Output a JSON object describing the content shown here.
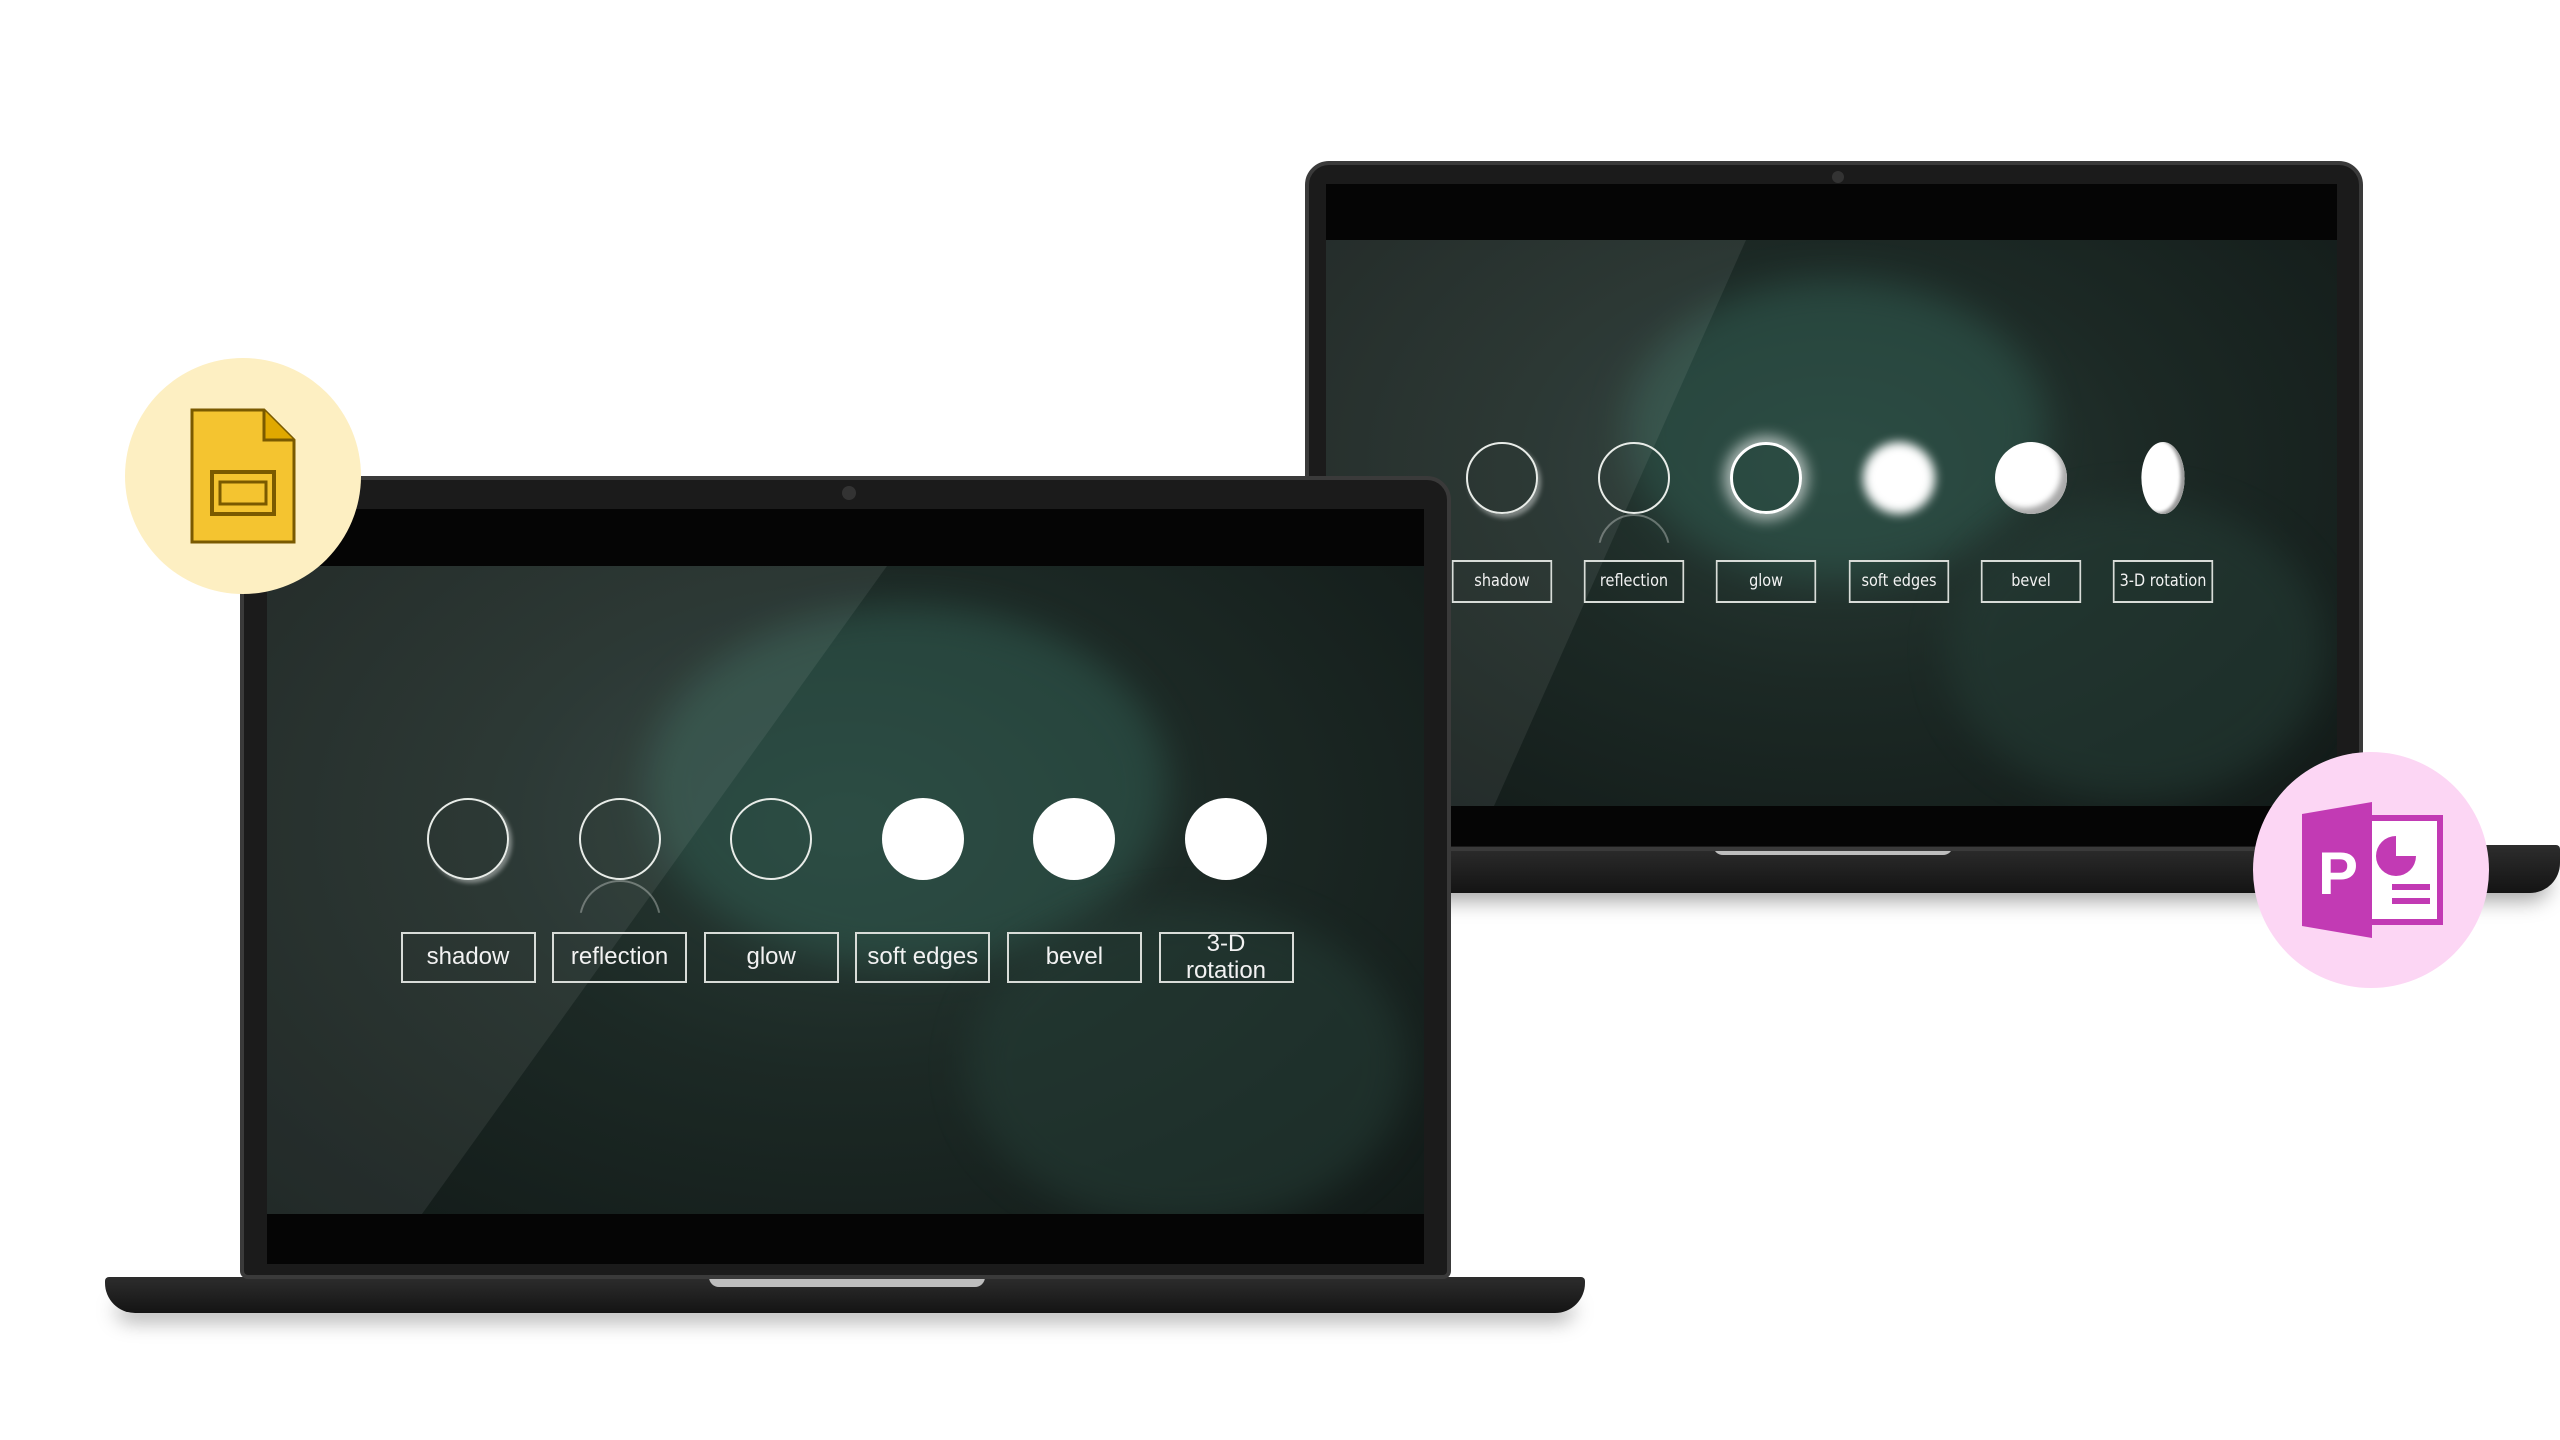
{
  "effects": [
    "shadow",
    "reflection",
    "glow",
    "soft edges",
    "bevel",
    "3-D rotation"
  ],
  "left_laptop": {
    "app": "Google Slides",
    "labels": [
      "shadow",
      "reflection",
      "glow",
      "soft edges",
      "bevel",
      "3-D\nrotation"
    ]
  },
  "right_laptop": {
    "app": "PowerPoint",
    "labels": [
      "shadow",
      "reflection",
      "glow",
      "soft edges",
      "bevel",
      "3-D rotation"
    ]
  },
  "colors": {
    "slides_badge": "#fdefc2",
    "slides_icon": "#f4c430",
    "ppt_badge": "#fcd6f4",
    "ppt_icon": "#c23ab4",
    "screen_bg": "#1c2925"
  },
  "icons": {
    "slides": "google-slides-icon",
    "powerpoint": "powerpoint-icon"
  }
}
